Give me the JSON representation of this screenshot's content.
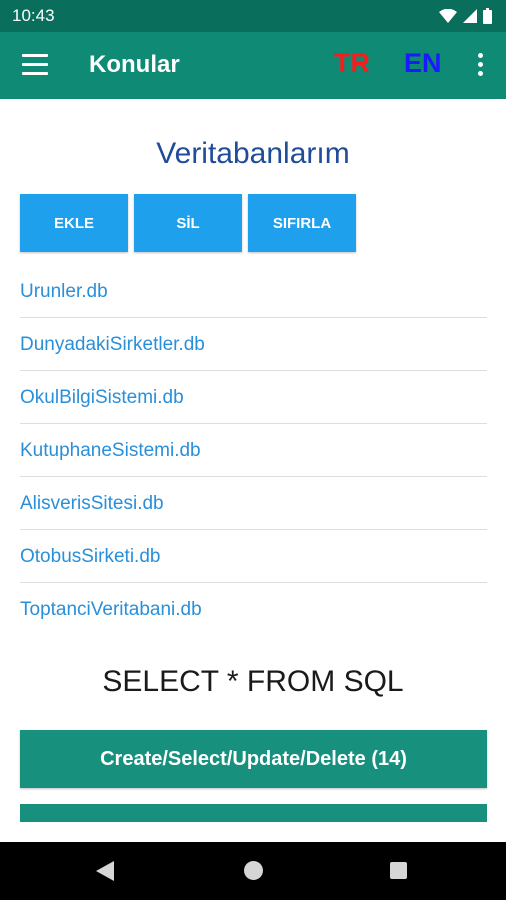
{
  "status_bar": {
    "time": "10:43",
    "icons": [
      "wifi-icon",
      "signal-icon",
      "battery-icon"
    ]
  },
  "app_bar": {
    "title": "Konular",
    "lang_tr": "TR",
    "lang_en": "EN",
    "color": "#0e8a75"
  },
  "databases": {
    "title": "Veritabanlarım",
    "buttons": [
      {
        "label": "EKLE"
      },
      {
        "label": "SİL"
      },
      {
        "label": "SIFIRLA"
      }
    ],
    "items": [
      "Urunler.db",
      "DunyadakiSirketler.db",
      "OkulBilgiSistemi.db",
      "KutuphaneSistemi.db",
      "AlisverisSitesi.db",
      "OtobusSirketi.db",
      "ToptanciVeritabani.db"
    ]
  },
  "sql": {
    "title": "SELECT * FROM SQL",
    "crud_label": "Create/Select/Update/Delete (14)"
  },
  "colors": {
    "accent_blue": "#1ea0ec",
    "primary_green": "#17907e",
    "lang_tr": "#ff1a1a",
    "lang_en": "#1a1aff"
  }
}
